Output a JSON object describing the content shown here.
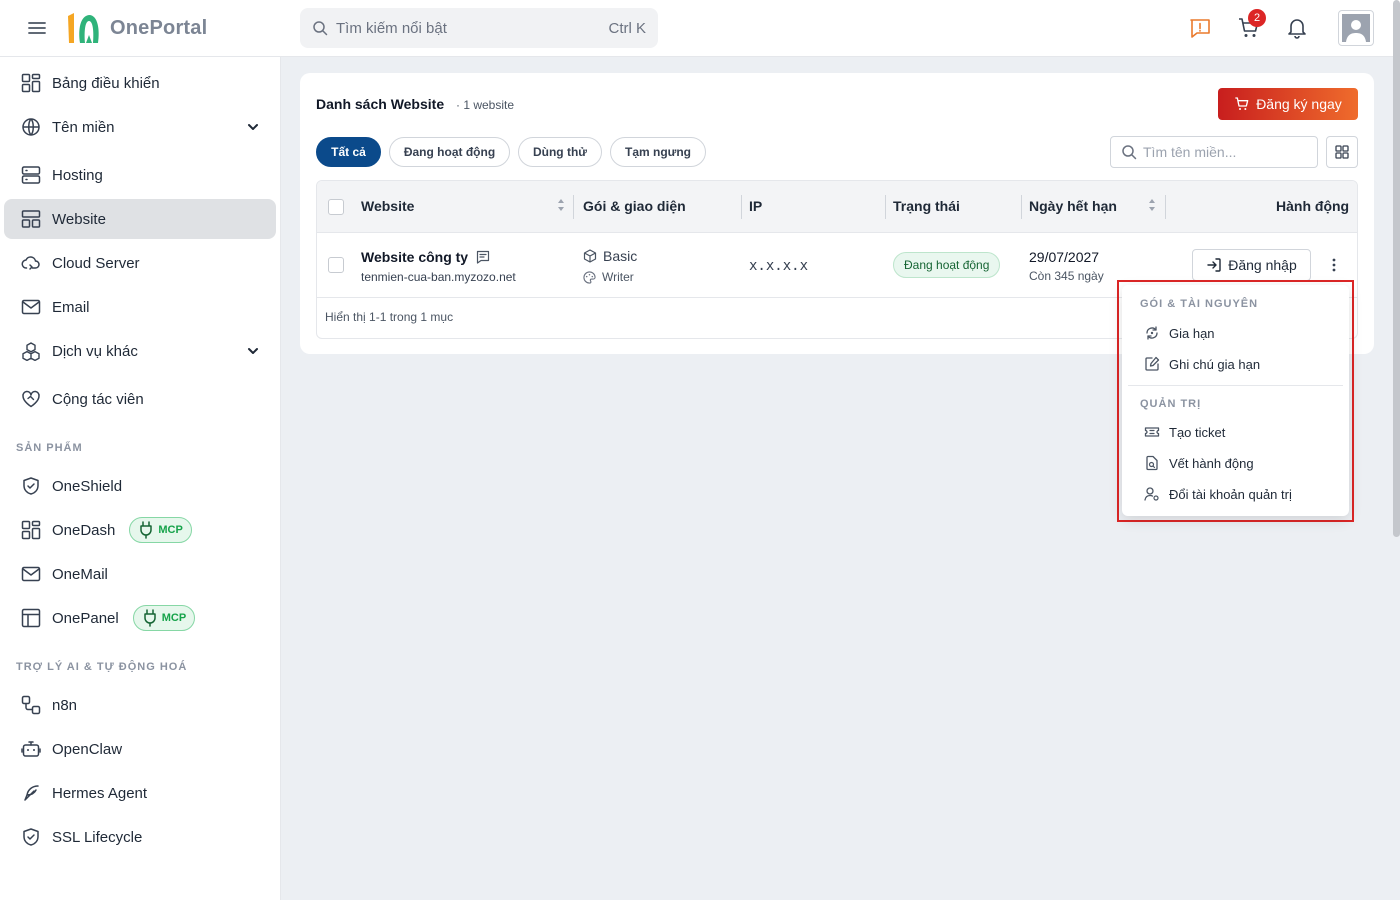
{
  "header": {
    "logo_text": "OnePortal",
    "search_placeholder": "Tìm kiếm nổi bật",
    "search_shortcut": "Ctrl K",
    "cart_count": "2"
  },
  "sidebar": {
    "items": [
      {
        "label": "Bảng điều khiển"
      },
      {
        "label": "Tên miền"
      },
      {
        "label": "Hosting"
      },
      {
        "label": "Website"
      },
      {
        "label": "Cloud Server"
      },
      {
        "label": "Email"
      },
      {
        "label": "Dịch vụ khác"
      },
      {
        "label": "Cộng tác viên"
      }
    ],
    "section_products": "SẢN PHẨM",
    "products": [
      {
        "label": "OneShield"
      },
      {
        "label": "OneDash",
        "badge": "MCP"
      },
      {
        "label": "OneMail"
      },
      {
        "label": "OnePanel",
        "badge": "MCP"
      }
    ],
    "section_ai": "TRỢ LÝ AI & TỰ ĐỘNG HOÁ",
    "ai_items": [
      {
        "label": "n8n"
      },
      {
        "label": "OpenClaw"
      },
      {
        "label": "Hermes Agent"
      },
      {
        "label": "SSL Lifecycle"
      }
    ]
  },
  "main": {
    "title": "Danh sách Website",
    "count": "· 1 website",
    "register_button": "Đăng ký ngay",
    "filters": [
      "Tất cả",
      "Đang hoạt động",
      "Dùng thử",
      "Tạm ngưng"
    ],
    "domain_search_placeholder": "Tìm tên miền...",
    "columns": [
      "Website",
      "Gói & giao diện",
      "IP",
      "Trạng thái",
      "Ngày hết hạn",
      "Hành động"
    ],
    "rows": [
      {
        "name": "Website công ty",
        "domain": "tenmien-cua-ban.myzozo.net",
        "plan": "Basic",
        "theme": "Writer",
        "ip": "x.x.x.x",
        "status": "Đang hoạt động",
        "expire_date": "29/07/2027",
        "expire_remaining": "Còn 345 ngày",
        "login_button": "Đăng nhập"
      }
    ],
    "footer": "Hiển thị 1-1 trong 1 mục"
  },
  "dropdown": {
    "section_1": "GÓI & TÀI NGUYÊN",
    "items_1": [
      "Gia hạn",
      "Ghi chú gia hạn"
    ],
    "section_2": "QUẢN TRỊ",
    "items_2": [
      "Tạo ticket",
      "Vết hành động",
      "Đổi tài khoản quản trị"
    ]
  },
  "colors": {
    "primary": "#0b4a8b",
    "accent_gradient_start": "#c81e1e",
    "accent_gradient_end": "#ef6c2c",
    "success": "#16a34a",
    "highlight": "#dc2626"
  }
}
